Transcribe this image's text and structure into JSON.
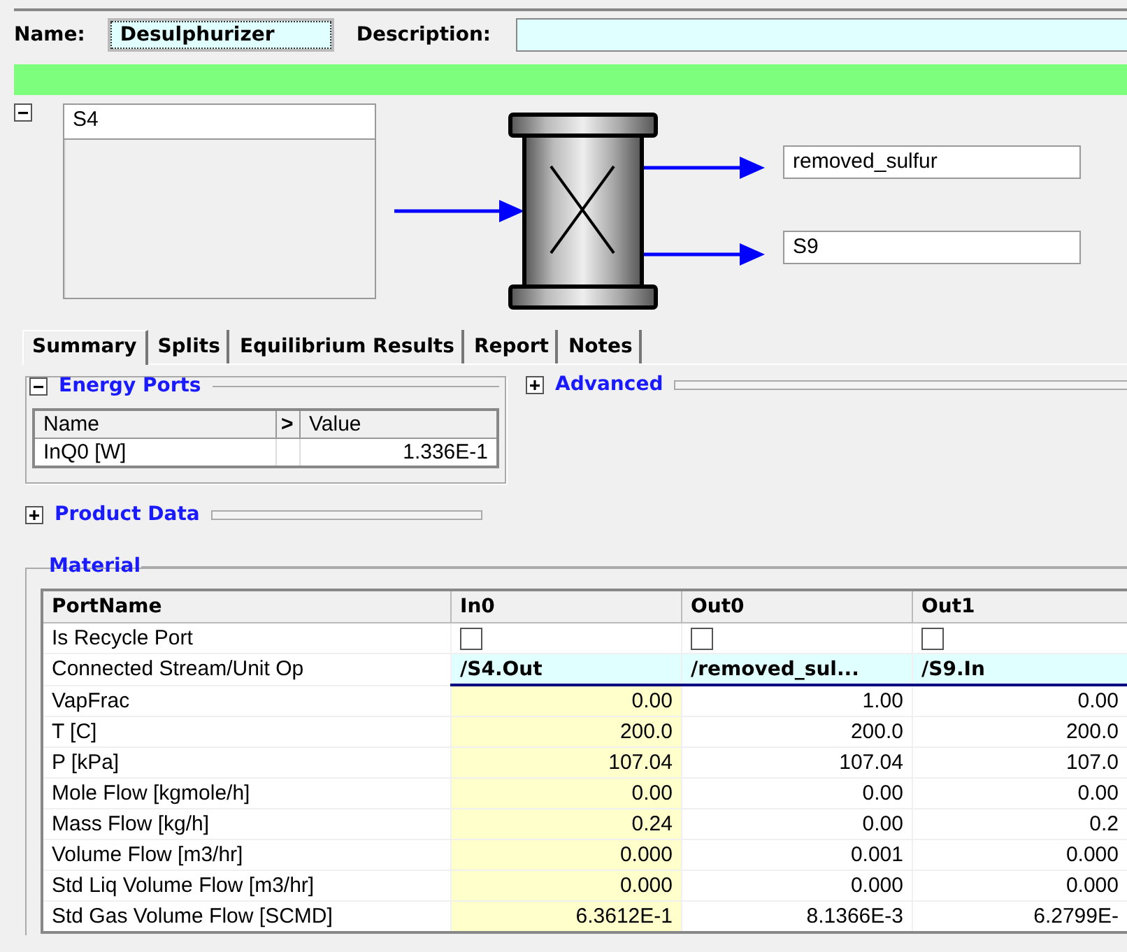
{
  "header": {
    "name_label": "Name:",
    "name_value": "Desulphurizer",
    "description_label": "Description:"
  },
  "feeds": {
    "expanded": true,
    "items": [
      "S4"
    ]
  },
  "products": [
    "removed_sulfur",
    "S9"
  ],
  "tabs": [
    {
      "label": "Summary",
      "selected": true
    },
    {
      "label": "Splits",
      "selected": false
    },
    {
      "label": "Equilibrium Results",
      "selected": false
    },
    {
      "label": "Report",
      "selected": false
    },
    {
      "label": "Notes",
      "selected": false
    }
  ],
  "energy_ports": {
    "title": "Energy Ports",
    "expanded": true,
    "columns": [
      "Name",
      ">",
      "Value"
    ],
    "rows": [
      {
        "name": "InQ0 [W]",
        "value": "1.336E-1"
      }
    ]
  },
  "advanced": {
    "title": "Advanced",
    "expanded": false
  },
  "product_data": {
    "title": "Product Data",
    "expanded": false
  },
  "material": {
    "title": "Material",
    "row_header": "PortName",
    "columns": [
      {
        "label": "In0",
        "specified": true
      },
      {
        "label": "Out0",
        "specified": false
      },
      {
        "label": "Out1",
        "specified": false
      }
    ],
    "rows": [
      {
        "kind": "checkbox",
        "label": "Is Recycle Port",
        "cells": [
          {
            "checked": false
          },
          {
            "checked": false
          },
          {
            "checked": false
          }
        ]
      },
      {
        "kind": "link",
        "label": "Connected Stream/Unit Op",
        "cells": [
          "/S4.Out",
          "/removed_sul...",
          "/S9.In"
        ]
      },
      {
        "kind": "value",
        "label": "VapFrac",
        "cells": [
          "0.00",
          "1.00",
          "0.00"
        ]
      },
      {
        "kind": "value",
        "label": "T [C]",
        "cells": [
          "200.0",
          "200.0",
          "200.0"
        ]
      },
      {
        "kind": "value",
        "label": "P [kPa]",
        "cells": [
          "107.04",
          "107.04",
          "107.0"
        ]
      },
      {
        "kind": "value",
        "label": "Mole Flow [kgmole/h]",
        "cells": [
          "0.00",
          "0.00",
          "0.00"
        ]
      },
      {
        "kind": "value",
        "label": "Mass Flow [kg/h]",
        "cells": [
          "0.24",
          "0.00",
          "0.2"
        ]
      },
      {
        "kind": "value",
        "label": "Volume Flow [m3/hr]",
        "cells": [
          "0.000",
          "0.001",
          "0.000"
        ]
      },
      {
        "kind": "value",
        "label": "Std Liq Volume Flow [m3/hr]",
        "cells": [
          "0.000",
          "0.000",
          "0.000"
        ]
      },
      {
        "kind": "value",
        "label": "Std Gas Volume Flow [SCMD]",
        "cells": [
          "6.3612E-1",
          "8.1366E-3",
          "6.2799E-"
        ]
      }
    ]
  }
}
